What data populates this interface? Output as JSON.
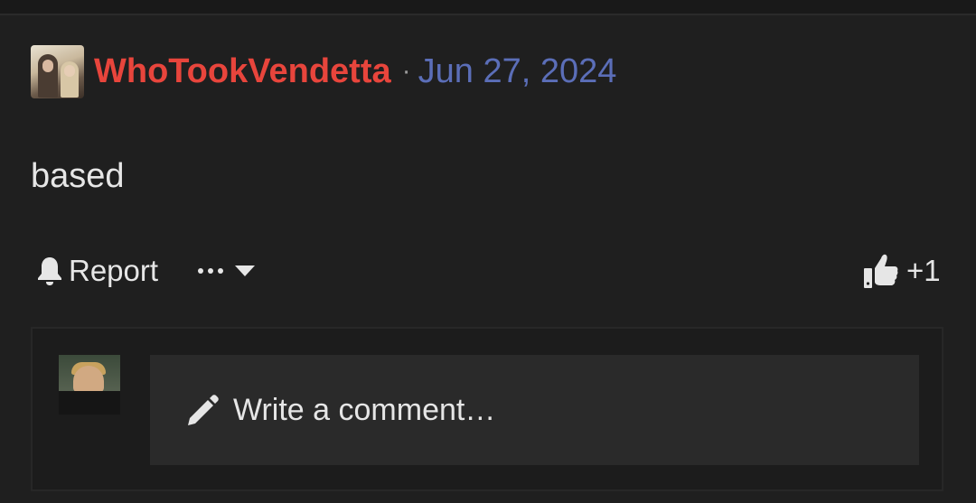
{
  "post": {
    "username": "WhoTookVendetta",
    "separator": "·",
    "date": "Jun 27, 2024",
    "body": "based"
  },
  "actions": {
    "report_label": "Report",
    "like_count": "+1"
  },
  "comment": {
    "placeholder": "Write a comment…"
  },
  "colors": {
    "username": "#e8453c",
    "date": "#5b6eb8",
    "background": "#1f1f1f"
  },
  "icons": {
    "report": "bell-icon",
    "more": "ellipsis-icon",
    "dropdown": "caret-down-icon",
    "like": "thumbs-up-icon",
    "write": "pencil-icon"
  }
}
